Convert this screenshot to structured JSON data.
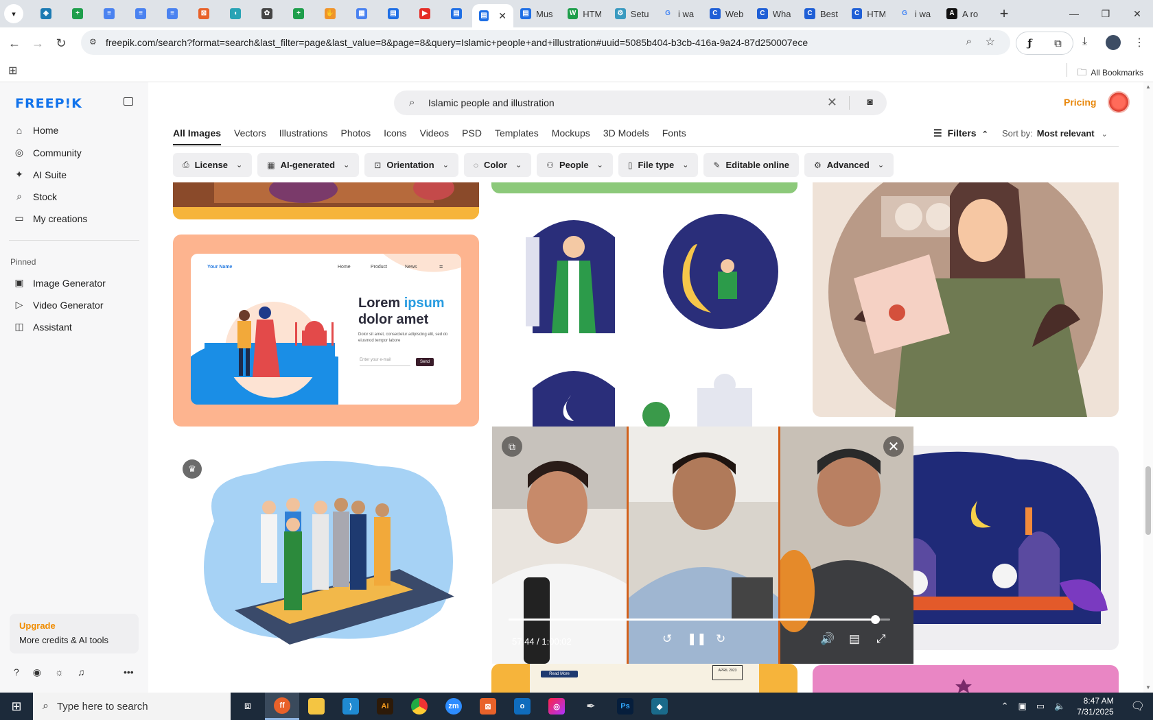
{
  "browser": {
    "tabs": [
      {
        "icon": "tab-search-icon",
        "title": ""
      },
      {
        "icon": "vpn-icon",
        "title": ""
      },
      {
        "icon": "sheets-icon",
        "title": ""
      },
      {
        "icon": "docs-icon",
        "title": ""
      },
      {
        "icon": "docs-icon",
        "title": ""
      },
      {
        "icon": "docs-icon",
        "title": ""
      },
      {
        "icon": "code-icon",
        "title": ""
      },
      {
        "icon": "app-icon",
        "title": ""
      },
      {
        "icon": "chatgpt-icon",
        "title": ""
      },
      {
        "icon": "sheets-icon",
        "title": ""
      },
      {
        "icon": "hand-icon",
        "title": ""
      },
      {
        "icon": "grid-icon",
        "title": ""
      },
      {
        "icon": "docs-blue-icon",
        "title": ""
      },
      {
        "icon": "youtube-icon",
        "title": ""
      },
      {
        "icon": "docs-blue-icon",
        "title": ""
      },
      {
        "icon": "docs-blue-icon",
        "title": ""
      },
      {
        "icon": "docs-blue-icon",
        "title": "Mus"
      },
      {
        "icon": "w-icon",
        "title": "HTM"
      },
      {
        "icon": "gear-icon",
        "title": "Setu"
      },
      {
        "icon": "google-icon",
        "title": "i wa"
      },
      {
        "icon": "c-icon",
        "title": "Web"
      },
      {
        "icon": "c-icon",
        "title": "Wha"
      },
      {
        "icon": "c-icon",
        "title": "Best"
      },
      {
        "icon": "c-icon",
        "title": "HTM"
      },
      {
        "icon": "google-icon",
        "title": "i wa"
      },
      {
        "icon": "a-icon",
        "title": "A ro"
      }
    ],
    "url": "freepik.com/search?format=search&last_filter=page&last_value=8&page=8&query=Islamic+people+and+illustration#uuid=5085b404-b3cb-416a-9a24-87d250007ece",
    "bookmarks_label": "All Bookmarks"
  },
  "sidebar": {
    "logo": "FREEP!K",
    "nav": [
      {
        "label": "Home",
        "icon": "home-icon"
      },
      {
        "label": "Community",
        "icon": "globe-icon"
      },
      {
        "label": "AI Suite",
        "icon": "sparkle-icon"
      },
      {
        "label": "Stock",
        "icon": "search-icon"
      },
      {
        "label": "My creations",
        "icon": "folder-icon"
      }
    ],
    "pinned_label": "Pinned",
    "pinned": [
      {
        "label": "Image Generator",
        "icon": "image-icon"
      },
      {
        "label": "Video Generator",
        "icon": "video-icon"
      },
      {
        "label": "Assistant",
        "icon": "assistant-icon"
      }
    ],
    "upgrade_title": "Upgrade",
    "upgrade_text": "More credits & AI tools"
  },
  "search": {
    "query": "Islamic people and illustration"
  },
  "header": {
    "pricing": "Pricing"
  },
  "categories": [
    "All Images",
    "Vectors",
    "Illustrations",
    "Photos",
    "Icons",
    "Videos",
    "PSD",
    "Templates",
    "Mockups",
    "3D Models",
    "Fonts"
  ],
  "filters_label": "Filters",
  "sort": {
    "label": "Sort by:",
    "value": "Most relevant"
  },
  "chips": [
    {
      "label": "License",
      "icon": "license-icon"
    },
    {
      "label": "AI-generated",
      "icon": "ai-icon"
    },
    {
      "label": "Orientation",
      "icon": "orientation-icon"
    },
    {
      "label": "Color",
      "icon": "palette-icon"
    },
    {
      "label": "People",
      "icon": "people-icon"
    },
    {
      "label": "File type",
      "icon": "file-icon"
    },
    {
      "label": "Editable online",
      "icon": "pen-icon"
    },
    {
      "label": "Advanced",
      "icon": "settings-icon"
    }
  ],
  "landing_mock": {
    "brand": "Your Name",
    "nav": [
      "Home",
      "Product",
      "News"
    ],
    "headline_1": "Lorem ",
    "headline_accent": "ipsum",
    "headline_2": "dolor amet",
    "body": "Dolor sit amet, consectetur adipiscing elit, sed do eiusmod tempor labore",
    "email_placeholder": "Enter your e-mail",
    "send": "Send"
  },
  "bottom_card": {
    "read_more": "Read More",
    "date": "APRIL 2023"
  },
  "video": {
    "time": "57:44 / 1:00:02",
    "progress": 0.961
  },
  "taskbar": {
    "search_placeholder": "Type here to search",
    "time": "8:47 AM",
    "date": "7/31/2025"
  }
}
